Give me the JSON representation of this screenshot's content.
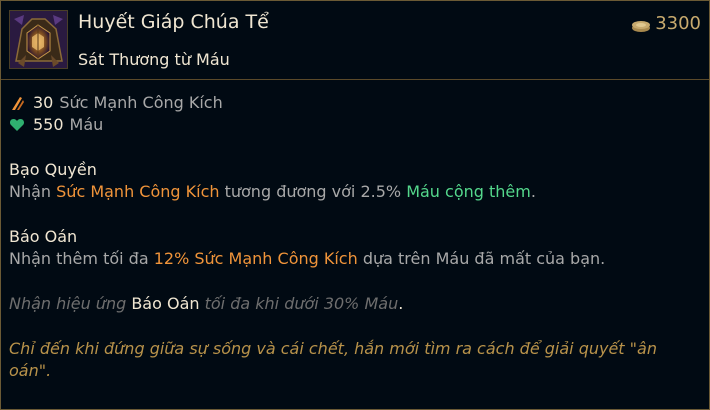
{
  "item": {
    "name": "Huyết Giáp Chúa Tể",
    "subtitle": "Sát Thương từ Máu",
    "cost": "3300",
    "icon": "bloodmail-armor-icon"
  },
  "stats": [
    {
      "value": "30",
      "label": "Sức Mạnh Công Kích",
      "icon": "attack-damage-icon",
      "color": "#f0943a"
    },
    {
      "value": "550",
      "label": "Máu",
      "icon": "health-heart-icon",
      "color": "#54d88c"
    }
  ],
  "passive1": {
    "name": "Bạo Quyền",
    "p1": "Nhận ",
    "hl1": "Sức Mạnh Công Kích",
    "p2": " tương đương với 2.5% ",
    "hl2": "Máu cộng thêm",
    "p3": "."
  },
  "passive2": {
    "name": "Báo Oán",
    "p1": "Nhận thêm tối đa ",
    "hl1": "12% Sức Mạnh Công Kích",
    "p2": " dựa trên Máu đã mất của bạn."
  },
  "note": {
    "p1": "Nhận hiệu ứng ",
    "hl": "Báo Oán",
    "p2": " tối đa khi dưới 30% Máu",
    "p3": "."
  },
  "lore": "Chỉ đến khi đứng giữa sự sống và cái chết, hắn mới tìm ra cách để giải quyết \"ân oán\".",
  "colors": {
    "background": "#010a13",
    "border": "#6b5a35",
    "gold": "#c8aa6e",
    "title": "#f0e6d2",
    "text": "#a8a8a8",
    "attack_damage": "#f0943a",
    "health": "#54d88c",
    "lore": "#b8924a"
  }
}
